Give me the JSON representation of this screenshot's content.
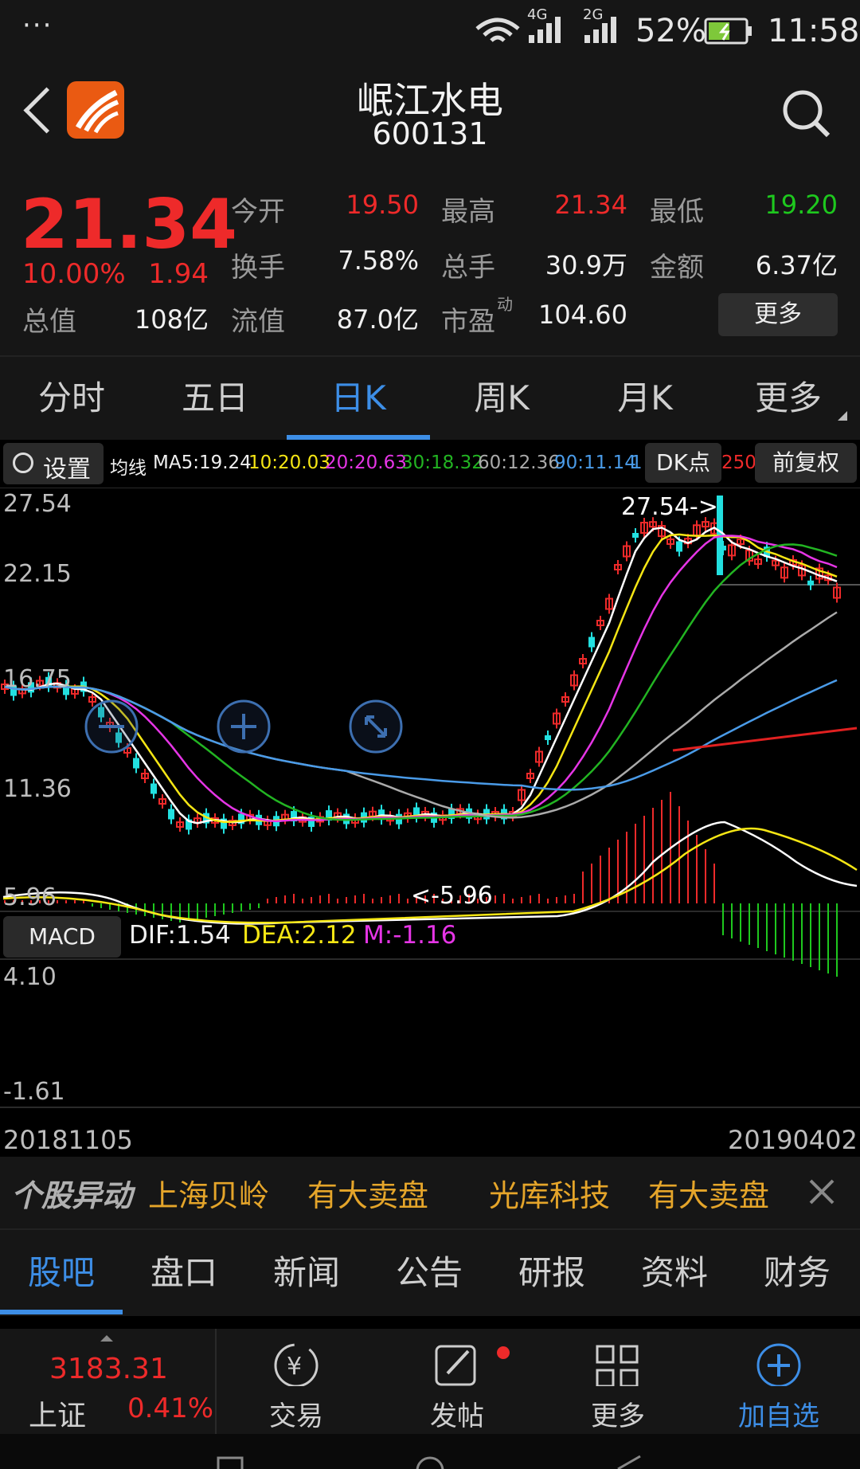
{
  "status_bar": {
    "menu": "···",
    "network_1": "4G",
    "network_2": "2G",
    "battery": "52%",
    "time": "11:58"
  },
  "header": {
    "title": "岷江水电",
    "code": "600131"
  },
  "quote": {
    "price": "21.34",
    "change_pct": "10.00%",
    "change_amt": "1.94",
    "rows": [
      [
        {
          "label": "今开",
          "value": "19.50",
          "color": "red"
        },
        {
          "label": "最高",
          "value": "21.34",
          "color": "red"
        },
        {
          "label": "最低",
          "value": "19.20",
          "color": "green"
        }
      ],
      [
        {
          "label": "换手",
          "value": "7.58%",
          "color": "white"
        },
        {
          "label": "总手",
          "value": "30.9万",
          "color": "white"
        },
        {
          "label": "金额",
          "value": "6.37亿",
          "color": "white"
        }
      ]
    ],
    "total_value_label": "总值",
    "total_value": "108亿",
    "float_value_label": "流值",
    "float_value": "87.0亿",
    "pe_label": "市盈",
    "pe_sup": "动",
    "pe_value": "104.60",
    "more_button": "更多"
  },
  "period_tabs": [
    "分时",
    "五日",
    "日K",
    "周K",
    "月K",
    "更多"
  ],
  "active_period": 2,
  "ma_row": {
    "settings_label": "设置",
    "prefix": "均线",
    "items": [
      {
        "text": "MA5:19.24",
        "color": "#f0f0f0"
      },
      {
        "text": "10:20.03",
        "color": "#f5e614"
      },
      {
        "text": "20:20.63",
        "color": "#e635e6"
      },
      {
        "text": "30:18.32",
        "color": "#22b422"
      },
      {
        "text": "60:12.36",
        "color": "#aaaaaa"
      },
      {
        "text": "90:11.14",
        "color": "#4a9be8"
      },
      {
        "text": "1",
        "color": "#4a9be8"
      }
    ],
    "hidden_tail": "250:",
    "dk_label": "DK点",
    "adjust_label": "前复权"
  },
  "chart_data": {
    "type": "candlestick",
    "x_start": "20181105",
    "x_end": "20190402",
    "price_ticks": [
      "27.54",
      "22.15",
      "16.75",
      "11.36",
      "5.96"
    ],
    "high_annotation": "27.54->",
    "low_annotation": "<-5.96",
    "ylim": [
      5.96,
      27.54
    ],
    "macd": {
      "label": "MACD",
      "dif": "DIF:1.54",
      "dea": "DEA:2.12",
      "m": "M:-1.16",
      "ticks": [
        "4.10",
        "-1.61"
      ],
      "ylim": [
        -1.61,
        4.1
      ]
    }
  },
  "news": {
    "brand": "个股异动",
    "items": [
      {
        "name": "上海贝岭",
        "event": "有大卖盘"
      },
      {
        "name": "光库科技",
        "event": "有大卖盘"
      }
    ]
  },
  "bottom_tabs": [
    "股吧",
    "盘口",
    "新闻",
    "公告",
    "研报",
    "资料",
    "财务"
  ],
  "active_bottom_tab": 0,
  "dock": {
    "index_value": "3183.31",
    "index_name": "上证",
    "index_change": "0.41%",
    "items": [
      {
        "label": "交易",
        "icon": "trade-icon"
      },
      {
        "label": "发帖",
        "icon": "post-icon"
      },
      {
        "label": "更多",
        "icon": "grid-icon"
      },
      {
        "label": "加自选",
        "icon": "add-watchlist-icon"
      }
    ]
  },
  "colors": {
    "up": "#ee2a2a",
    "down": "#1ec81e",
    "accent": "#3d8ee6"
  }
}
